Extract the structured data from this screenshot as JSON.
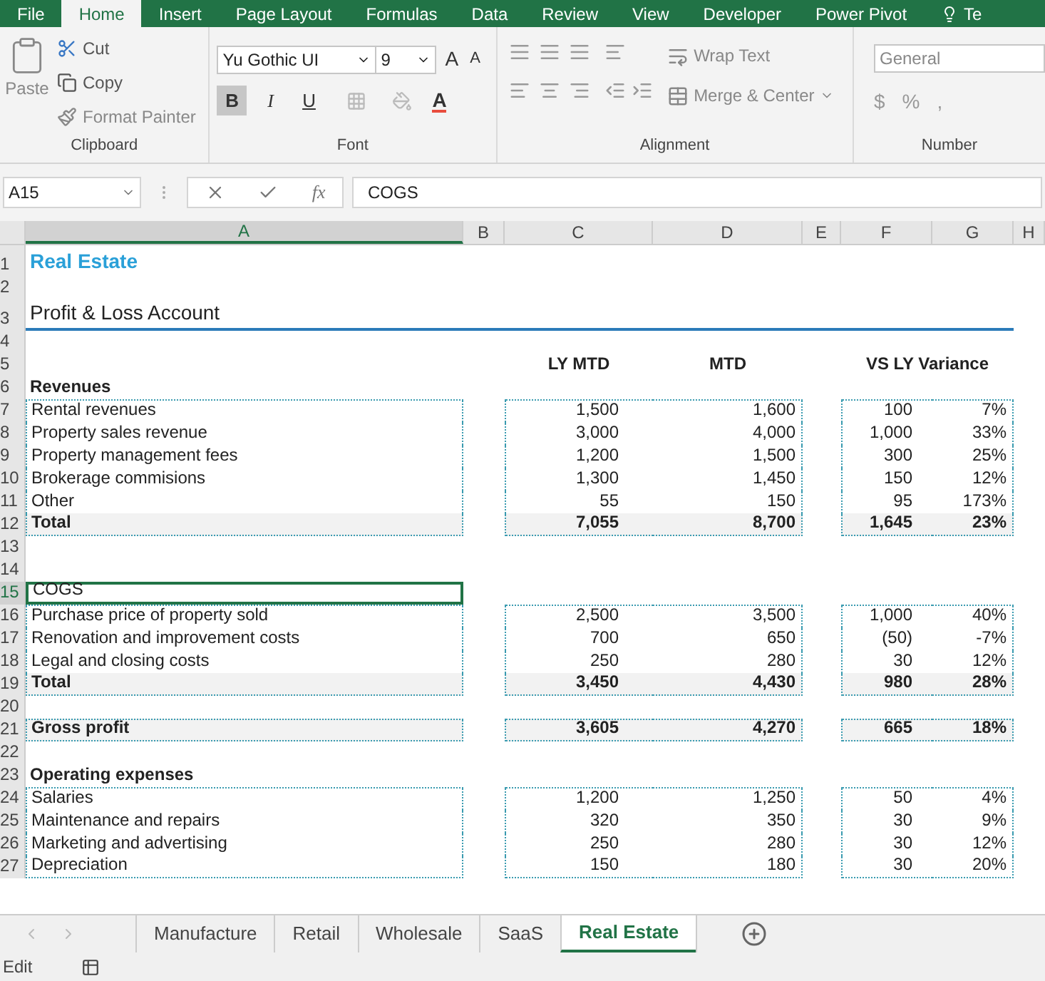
{
  "ribbon_tabs": [
    {
      "label": "File",
      "selected": false
    },
    {
      "label": "Home",
      "selected": true
    },
    {
      "label": "Insert",
      "selected": false
    },
    {
      "label": "Page Layout",
      "selected": false
    },
    {
      "label": "Formulas",
      "selected": false
    },
    {
      "label": "Data",
      "selected": false
    },
    {
      "label": "Review",
      "selected": false
    },
    {
      "label": "View",
      "selected": false
    },
    {
      "label": "Developer",
      "selected": false
    },
    {
      "label": "Power Pivot",
      "selected": false
    },
    {
      "label": "Te",
      "selected": false
    }
  ],
  "clipboard": {
    "paste": "Paste",
    "cut": "Cut",
    "copy": "Copy",
    "format_painter": "Format Painter",
    "group": "Clipboard"
  },
  "font": {
    "name": "Yu Gothic UI",
    "size": "9",
    "grow": "A",
    "shrink": "A",
    "styles": [
      {
        "label": "B",
        "selected": true
      },
      {
        "label": "I",
        "selected": false
      },
      {
        "label": "U",
        "selected": false
      }
    ],
    "font_color": "A",
    "group": "Font"
  },
  "alignment": {
    "wrap": "Wrap Text",
    "merge": "Merge & Center",
    "group": "Alignment"
  },
  "number": {
    "format": "General",
    "symbols": [
      "$",
      "%",
      ","
    ],
    "group": "Number"
  },
  "formula_bar": {
    "name_box": "A15",
    "fx": "fx",
    "value": "COGS"
  },
  "columns": [
    {
      "label": "A",
      "selected": true
    },
    {
      "label": "B",
      "selected": false
    },
    {
      "label": "C",
      "selected": false
    },
    {
      "label": "D",
      "selected": false
    },
    {
      "label": "E",
      "selected": false
    },
    {
      "label": "F",
      "selected": false
    },
    {
      "label": "G",
      "selected": false
    },
    {
      "label": "H",
      "selected": false
    }
  ],
  "rows": [
    {
      "n": "1",
      "kind": "title",
      "selected": false,
      "a": "Real Estate"
    },
    {
      "n": "2",
      "kind": "blank",
      "selected": false
    },
    {
      "n": "3",
      "kind": "heading",
      "selected": false,
      "a": "Profit & Loss Account"
    },
    {
      "n": "4",
      "kind": "blank",
      "selected": false
    },
    {
      "n": "5",
      "kind": "colheads",
      "selected": false,
      "c": "LY MTD",
      "d": "MTD",
      "f": "VS LY Variance"
    },
    {
      "n": "6",
      "kind": "section",
      "selected": false,
      "a": "Revenues"
    },
    {
      "n": "7",
      "kind": "item",
      "selected": false,
      "a": "Rental revenues",
      "c": "1,500",
      "d": "1,600",
      "f": "100",
      "g": "7%"
    },
    {
      "n": "8",
      "kind": "item",
      "selected": false,
      "a": "Property sales revenue",
      "c": "3,000",
      "d": "4,000",
      "f": "1,000",
      "g": "33%"
    },
    {
      "n": "9",
      "kind": "item",
      "selected": false,
      "a": "Property management fees",
      "c": "1,200",
      "d": "1,500",
      "f": "300",
      "g": "25%"
    },
    {
      "n": "10",
      "kind": "item",
      "selected": false,
      "a": "Brokerage commisions",
      "c": "1,300",
      "d": "1,450",
      "f": "150",
      "g": "12%"
    },
    {
      "n": "11",
      "kind": "item",
      "selected": false,
      "a": "Other",
      "c": "55",
      "d": "150",
      "f": "95",
      "g": "173%"
    },
    {
      "n": "12",
      "kind": "total",
      "selected": false,
      "a": "Total",
      "c": "7,055",
      "d": "8,700",
      "f": "1,645",
      "g": "23%"
    },
    {
      "n": "13",
      "kind": "blank",
      "selected": false
    },
    {
      "n": "14",
      "kind": "blank",
      "selected": false
    },
    {
      "n": "15",
      "kind": "plain",
      "selected": true,
      "a": "COGS"
    },
    {
      "n": "16",
      "kind": "item",
      "selected": false,
      "a": "Purchase price of property sold",
      "c": "2,500",
      "d": "3,500",
      "f": "1,000",
      "g": "40%"
    },
    {
      "n": "17",
      "kind": "item",
      "selected": false,
      "a": "Renovation and improvement costs",
      "c": "700",
      "d": "650",
      "f": "(50)",
      "g": "-7%"
    },
    {
      "n": "18",
      "kind": "item",
      "selected": false,
      "a": "Legal and closing costs",
      "c": "250",
      "d": "280",
      "f": "30",
      "g": "12%"
    },
    {
      "n": "19",
      "kind": "total",
      "selected": false,
      "a": "Total",
      "c": "3,450",
      "d": "4,430",
      "f": "980",
      "g": "28%"
    },
    {
      "n": "20",
      "kind": "blank",
      "selected": false
    },
    {
      "n": "21",
      "kind": "total",
      "selected": false,
      "a": "Gross profit",
      "c": "3,605",
      "d": "4,270",
      "f": "665",
      "g": "18%"
    },
    {
      "n": "22",
      "kind": "blank",
      "selected": false
    },
    {
      "n": "23",
      "kind": "section",
      "selected": false,
      "a": "Operating expenses"
    },
    {
      "n": "24",
      "kind": "item",
      "selected": false,
      "a": "Salaries",
      "c": "1,200",
      "d": "1,250",
      "f": "50",
      "g": "4%"
    },
    {
      "n": "25",
      "kind": "item",
      "selected": false,
      "a": "Maintenance and repairs",
      "c": "320",
      "d": "350",
      "f": "30",
      "g": "9%"
    },
    {
      "n": "26",
      "kind": "item",
      "selected": false,
      "a": "Marketing and advertising",
      "c": "250",
      "d": "280",
      "f": "30",
      "g": "12%"
    },
    {
      "n": "27",
      "kind": "item",
      "selected": false,
      "a": "Depreciation",
      "c": "150",
      "d": "180",
      "f": "30",
      "g": "20%"
    }
  ],
  "sheet_tabs": [
    {
      "label": "Manufacture",
      "selected": false
    },
    {
      "label": "Retail",
      "selected": false
    },
    {
      "label": "Wholesale",
      "selected": false
    },
    {
      "label": "SaaS",
      "selected": false
    },
    {
      "label": "Real Estate",
      "selected": true
    }
  ],
  "status_bar": {
    "mode": "Edit"
  }
}
